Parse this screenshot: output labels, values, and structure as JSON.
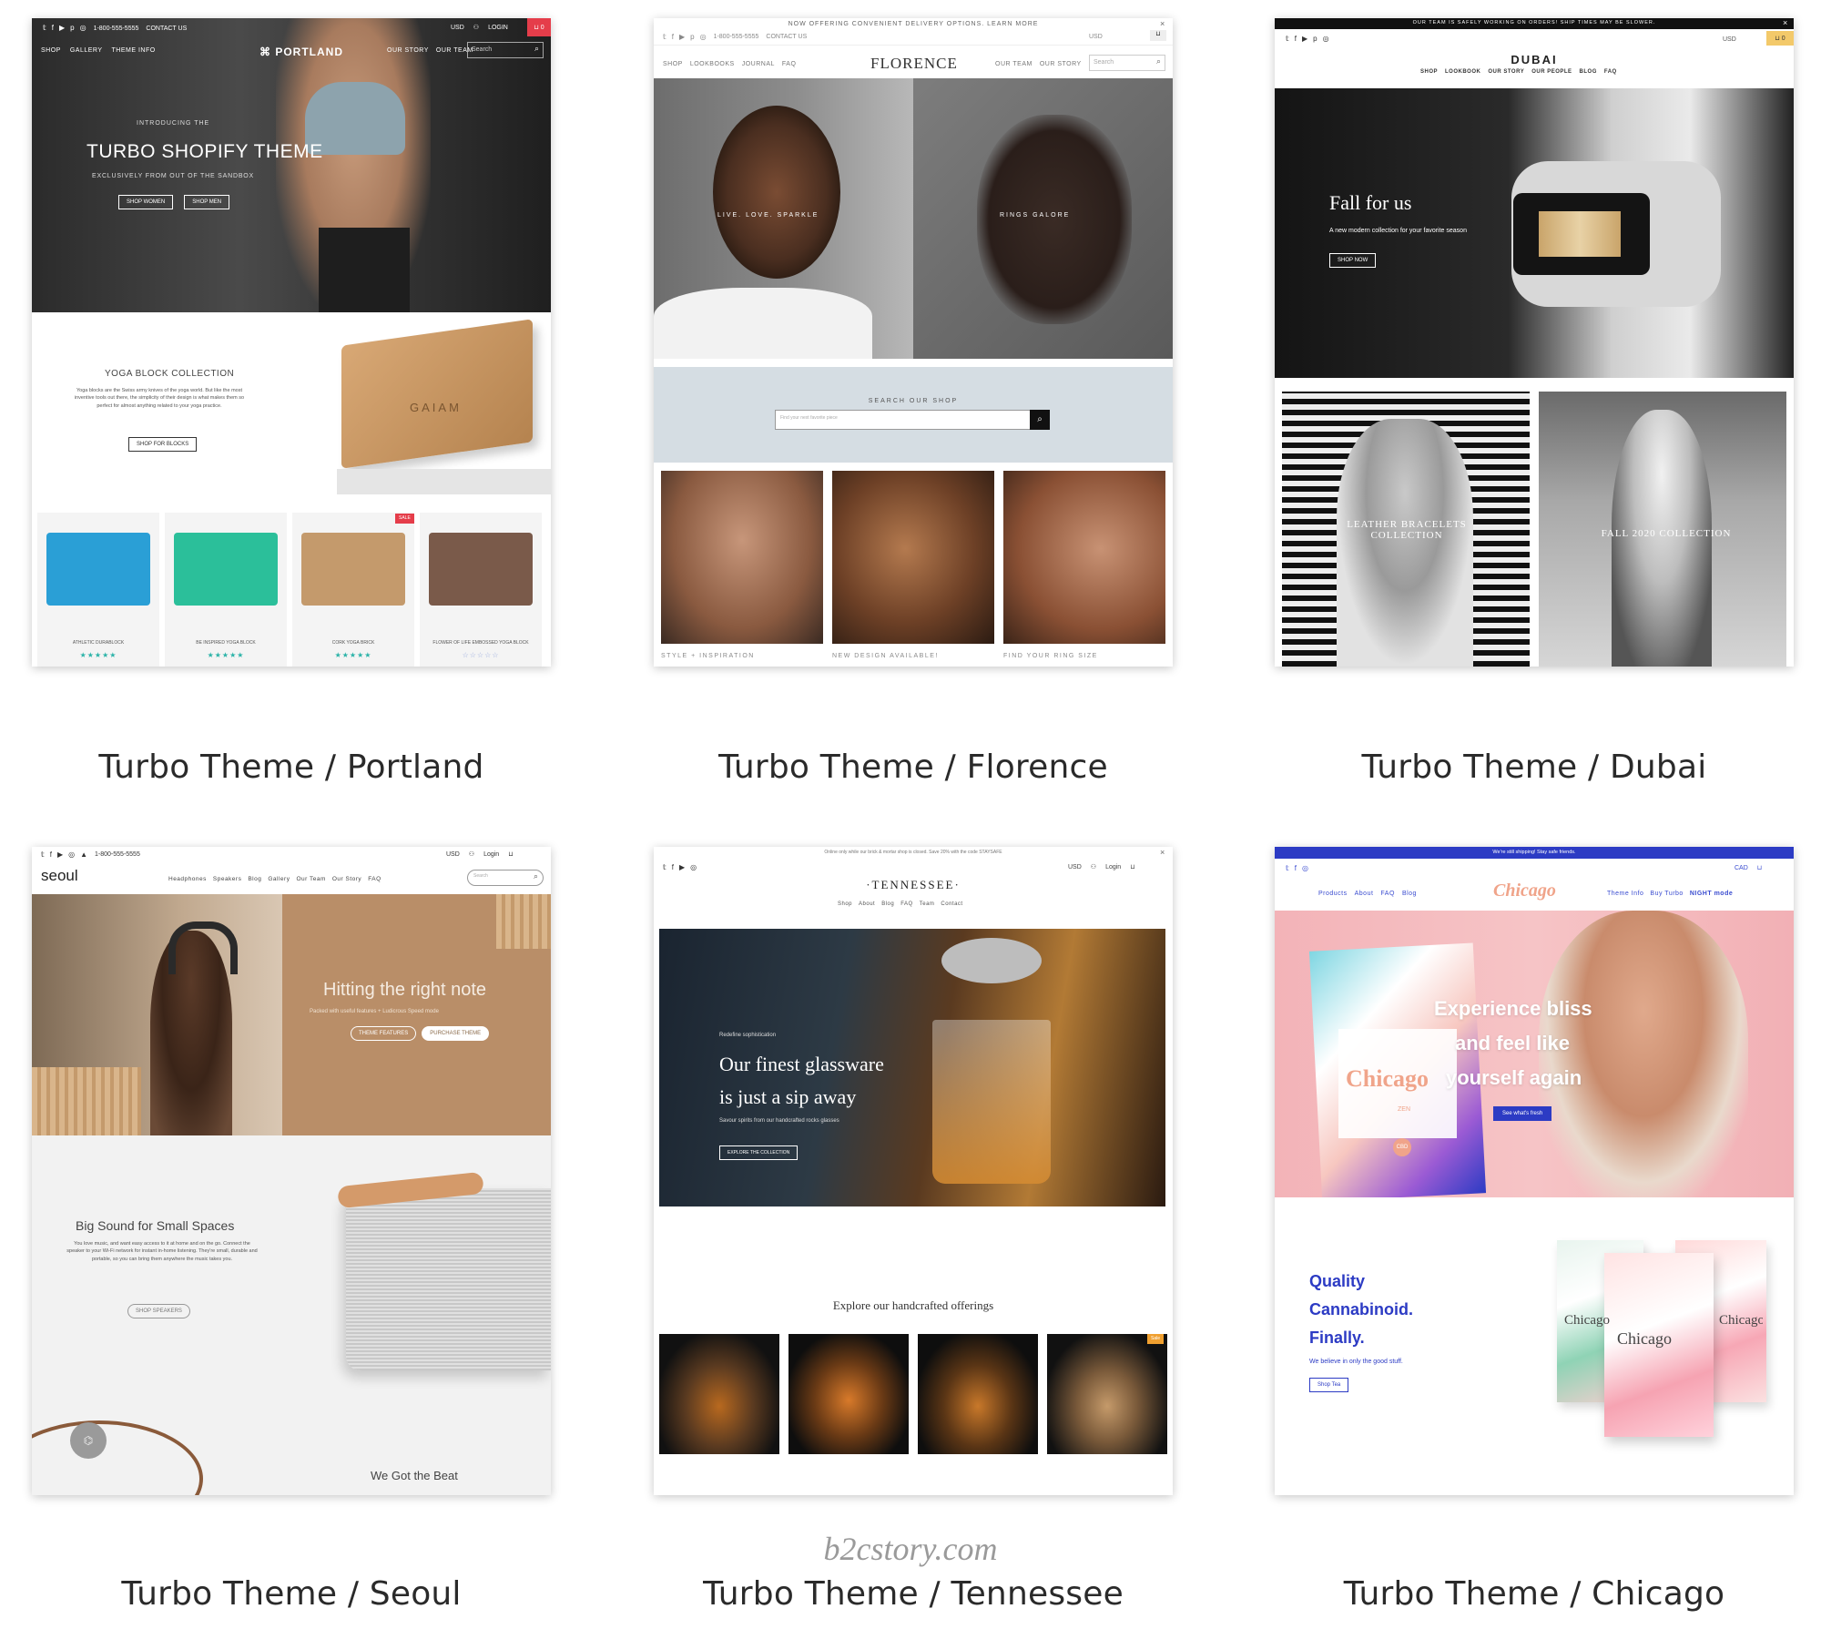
{
  "cards": [
    {
      "id": "portland",
      "caption": "Turbo Theme / Portland",
      "topbar": {
        "phone": "1-800-555-5555",
        "contact": "CONTACT US",
        "currency": "USD",
        "login": "LOGIN",
        "cart": "0"
      },
      "nav": {
        "left": [
          "SHOP",
          "GALLERY",
          "THEME INFO"
        ],
        "logo": "PORTLAND",
        "right": [
          "OUR STORY",
          "OUR TEAM"
        ],
        "search_placeholder": "Search"
      },
      "hero": {
        "kicker": "INTRODUCING THE",
        "title": "TURBO SHOPIFY THEME",
        "subtitle": "EXCLUSIVELY FROM OUT OF THE SANDBOX",
        "buttons": [
          "SHOP WOMEN",
          "SHOP MEN"
        ]
      },
      "feature": {
        "title": "YOGA BLOCK COLLECTION",
        "body": "Yoga blocks are the Swiss army knives of the yoga world. But like the most inventive tools out there, the simplicity of their design is what makes them so perfect for almost anything related to your yoga practice.",
        "button": "SHOP FOR BLOCKS",
        "brand": "GAIAM"
      },
      "products": [
        {
          "name": "ATHLETIC DURABLOCK",
          "stars": "★★★★★",
          "color": "#2a9fd6"
        },
        {
          "name": "BE INSPIRED YOGA BLOCK",
          "stars": "★★★★★",
          "color": "#2bbf9a"
        },
        {
          "name": "CORK YOGA BRICK",
          "stars": "★★★★★",
          "color": "#c49a6c"
        },
        {
          "name": "FLOWER OF LIFE EMBOSSED YOGA BLOCK",
          "stars": "☆☆☆☆☆",
          "color": "#7a5a4a"
        }
      ],
      "sale_badge": "SALE"
    },
    {
      "id": "florence",
      "caption": "Turbo Theme / Florence",
      "announcement": "NOW OFFERING CONVENIENT DELIVERY OPTIONS. LEARN MORE",
      "topbar": {
        "phone": "1-800-555-5555",
        "contact": "CONTACT US",
        "currency": "USD"
      },
      "nav": {
        "left": [
          "SHOP",
          "LOOKBOOKS",
          "JOURNAL",
          "FAQ"
        ],
        "logo": "FLORENCE",
        "right": [
          "OUR TEAM",
          "OUR STORY"
        ],
        "search_placeholder": "Search"
      },
      "hero": {
        "left_text": "LIVE. LOVE. SPARKLE",
        "right_text": "RINGS GALORE"
      },
      "search": {
        "title": "SEARCH OUR SHOP",
        "placeholder": "Find your next favorite piece"
      },
      "tiles": [
        "STYLE + INSPIRATION",
        "NEW DESIGN AVAILABLE!",
        "FIND YOUR RING SIZE"
      ]
    },
    {
      "id": "dubai",
      "caption": "Turbo Theme / Dubai",
      "announcement": "OUR TEAM IS SAFELY WORKING ON ORDERS! SHIP TIMES MAY BE SLOWER.",
      "topbar": {
        "currency": "USD",
        "cart": "0"
      },
      "nav": {
        "logo": "DUBAI",
        "items": [
          "SHOP",
          "LOOKBOOK",
          "OUR STORY",
          "OUR PEOPLE",
          "BLOG",
          "FAQ"
        ]
      },
      "hero": {
        "title": "Fall for us",
        "subtitle": "A new modern collection for your favorite season",
        "button": "SHOP NOW"
      },
      "tiles": [
        "LEATHER BRACELETS COLLECTION",
        "FALL 2020 COLLECTION"
      ]
    },
    {
      "id": "seoul",
      "caption": "Turbo Theme / Seoul",
      "topbar": {
        "phone": "1-800-555-5555",
        "currency": "USD",
        "login": "Login",
        "cart": "0"
      },
      "nav": {
        "logo": "seoul",
        "items": [
          "Headphones",
          "Speakers",
          "Blog",
          "Gallery",
          "Our Team",
          "Our Story",
          "FAQ"
        ],
        "search_placeholder": "Search"
      },
      "hero": {
        "title": "Hitting the right note",
        "subtitle": "Packed with useful features + Ludicrous Speed mode",
        "buttons": [
          "THEME FEATURES",
          "PURCHASE THEME"
        ]
      },
      "feature": {
        "title": "Big Sound for Small Spaces",
        "body": "You love music, and want easy access to it at home and on the go. Connect the speaker to your Wi-Fi network for instant in-home listening. They're small, durable and portable, so you can bring them anywhere the music takes you.",
        "button": "SHOP SPEAKERS"
      },
      "footer_text": "We Got the Beat"
    },
    {
      "id": "tennessee",
      "caption": "Turbo Theme / Tennessee",
      "announcement": "Online only while our brick & mortar shop is closed. Save 20% with the code STAYSAFE",
      "topbar": {
        "currency": "USD",
        "login": "Login",
        "cart": "0"
      },
      "nav": {
        "logo": "·TENNESSEE·",
        "items": [
          "Shop",
          "About",
          "Blog",
          "FAQ",
          "Team",
          "Contact"
        ]
      },
      "hero": {
        "kicker": "Redefine sophistication",
        "title_line1": "Our finest glassware",
        "title_line2": "is just a sip away",
        "subtitle": "Savour spirits from our handcrafted rocks glasses",
        "button": "EXPLORE THE COLLECTION"
      },
      "section_title": "Explore our handcrafted offerings",
      "sale_badge": "Sale"
    },
    {
      "id": "chicago",
      "caption": "Turbo Theme / Chicago",
      "announcement": "We're still shipping! Stay safe friends.",
      "topbar": {
        "currency": "CAD",
        "cart": "0"
      },
      "nav": {
        "left": [
          "Products",
          "About",
          "FAQ",
          "Blog"
        ],
        "logo": "Chicago",
        "right": [
          "Theme Info",
          "Buy Turbo",
          "NIGHT mode"
        ]
      },
      "hero": {
        "title_line1": "Experience bliss",
        "title_line2": "and feel like",
        "title_line3": "yourself again",
        "button": "See what's fresh",
        "pack_label": "Chicago",
        "pack_sub": "ZEN",
        "pack_badge": "CBD"
      },
      "feature": {
        "title_line1": "Quality",
        "title_line2": "Cannabinoid.",
        "title_line3": "Finally.",
        "body": "We believe in only the good stuff.",
        "button": "Shop Tea",
        "packs": [
          "Chicago",
          "Chicago",
          "Chicago"
        ]
      }
    }
  ],
  "watermark": "b2cstory.com"
}
